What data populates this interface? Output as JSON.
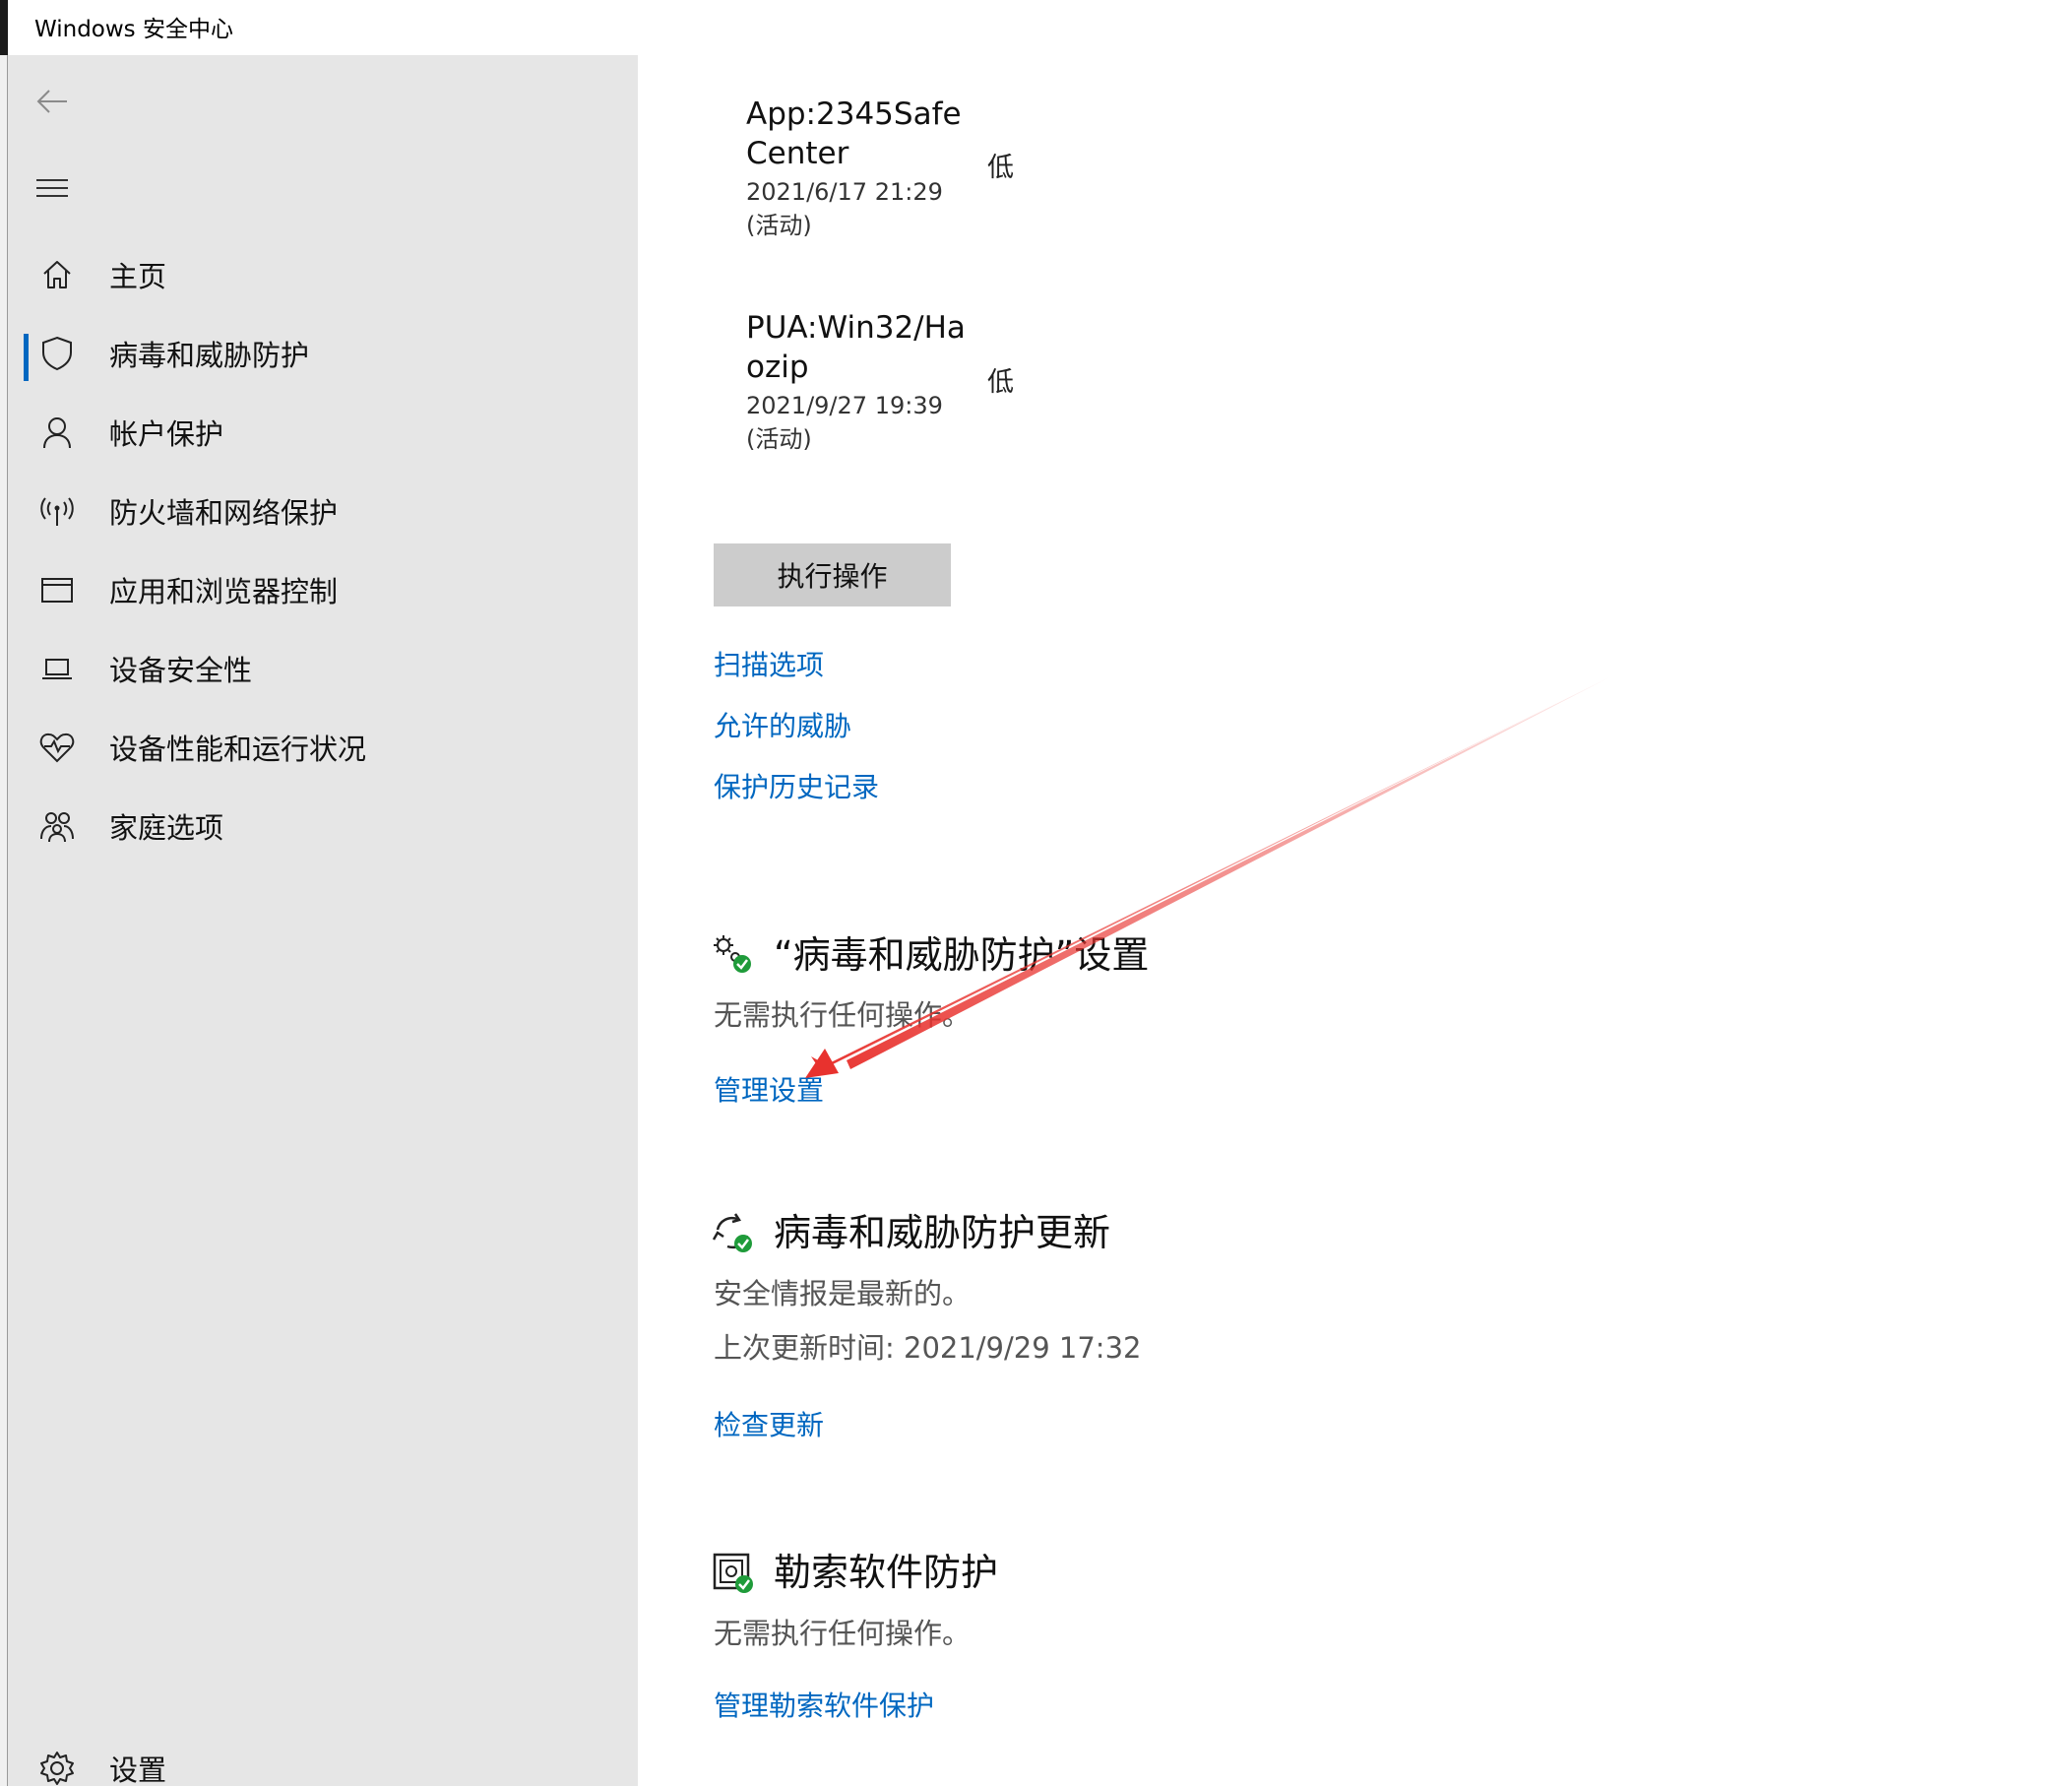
{
  "window": {
    "title": "Windows 安全中心"
  },
  "sidebar": {
    "items": [
      {
        "label": "主页",
        "icon": "home-icon"
      },
      {
        "label": "病毒和威胁防护",
        "icon": "shield-icon",
        "active": true
      },
      {
        "label": "帐户保护",
        "icon": "person-icon"
      },
      {
        "label": "防火墙和网络保护",
        "icon": "antenna-icon"
      },
      {
        "label": "应用和浏览器控制",
        "icon": "browser-window-icon"
      },
      {
        "label": "设备安全性",
        "icon": "laptop-icon"
      },
      {
        "label": "设备性能和运行状况",
        "icon": "heart-pulse-icon"
      },
      {
        "label": "家庭选项",
        "icon": "family-icon"
      }
    ],
    "settings_label": "设置"
  },
  "threats": [
    {
      "name": "App:2345SafeCenter",
      "date": "2021/6/17 21:29",
      "status": "(活动)",
      "level": "低"
    },
    {
      "name": "PUA:Win32/Haozip",
      "date": "2021/9/27 19:39",
      "status": "(活动)",
      "level": "低"
    }
  ],
  "actions": {
    "execute_button": "执行操作",
    "scan_options": "扫描选项",
    "allowed_threats": "允许的威胁",
    "protection_history": "保护历史记录"
  },
  "settings_section": {
    "title": "“病毒和威胁防护”设置",
    "description": "无需执行任何操作。",
    "link": "管理设置"
  },
  "updates_section": {
    "title": "病毒和威胁防护更新",
    "line1": "安全情报是最新的。",
    "line2": "上次更新时间: 2021/9/29 17:32",
    "link": "检查更新"
  },
  "ransomware_section": {
    "title": "勒索软件防护",
    "description": "无需执行任何操作。",
    "link": "管理勒索软件保护"
  },
  "colors": {
    "accent": "#0067c0",
    "sidebar_bg": "#e6e6e6",
    "annotation": "#e8322e",
    "check_green": "#1f9b3a"
  }
}
